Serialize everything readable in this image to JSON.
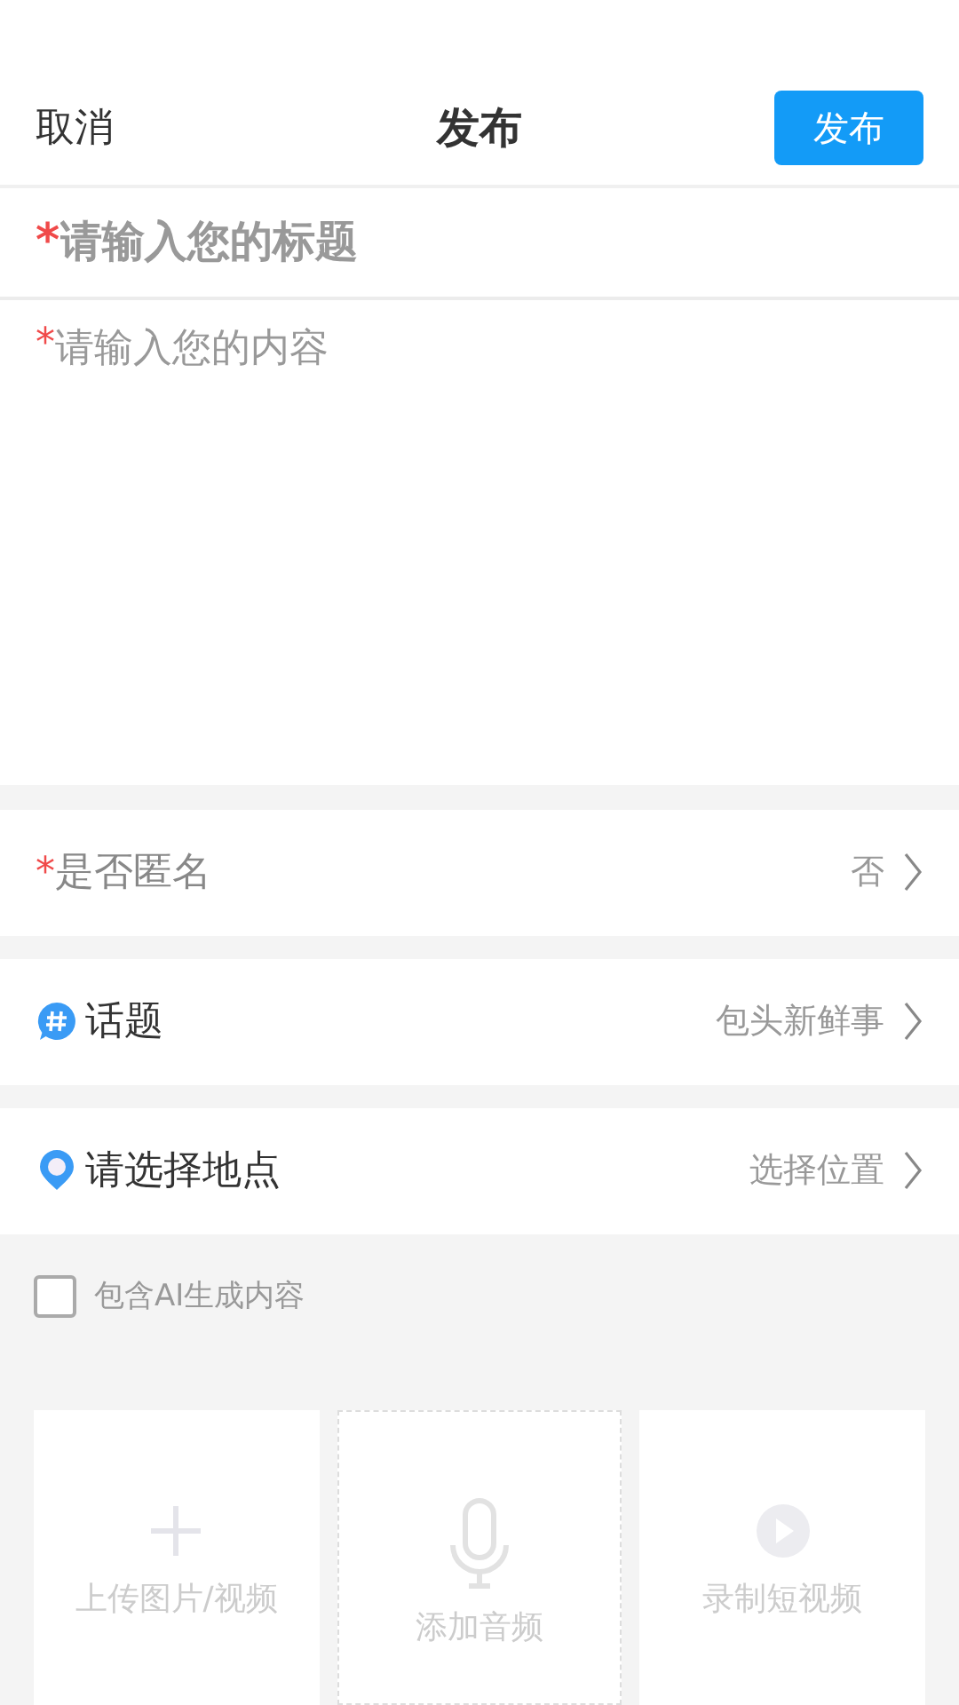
{
  "header": {
    "cancel": "取消",
    "title": "发布",
    "publish_button": "发布"
  },
  "required_mark": "*",
  "title_field": {
    "required": true,
    "placeholder": "请输入您的标题"
  },
  "content_field": {
    "required": true,
    "placeholder": "请输入您的内容"
  },
  "rows": [
    {
      "kind": "plain",
      "required": true,
      "label": "是否匿名",
      "value": "否"
    },
    {
      "kind": "topic",
      "required": false,
      "label": "话题",
      "value": "包头新鲜事"
    },
    {
      "kind": "location",
      "required": false,
      "label": "请选择地点",
      "value": "选择位置"
    }
  ],
  "ai_checkbox": {
    "label": "包含AI生成内容",
    "checked": false
  },
  "upload_tiles": [
    {
      "kind": "image",
      "label": "上传图片/视频"
    },
    {
      "kind": "audio",
      "label": "添加音频"
    },
    {
      "kind": "video",
      "label": "录制短视频"
    }
  ]
}
